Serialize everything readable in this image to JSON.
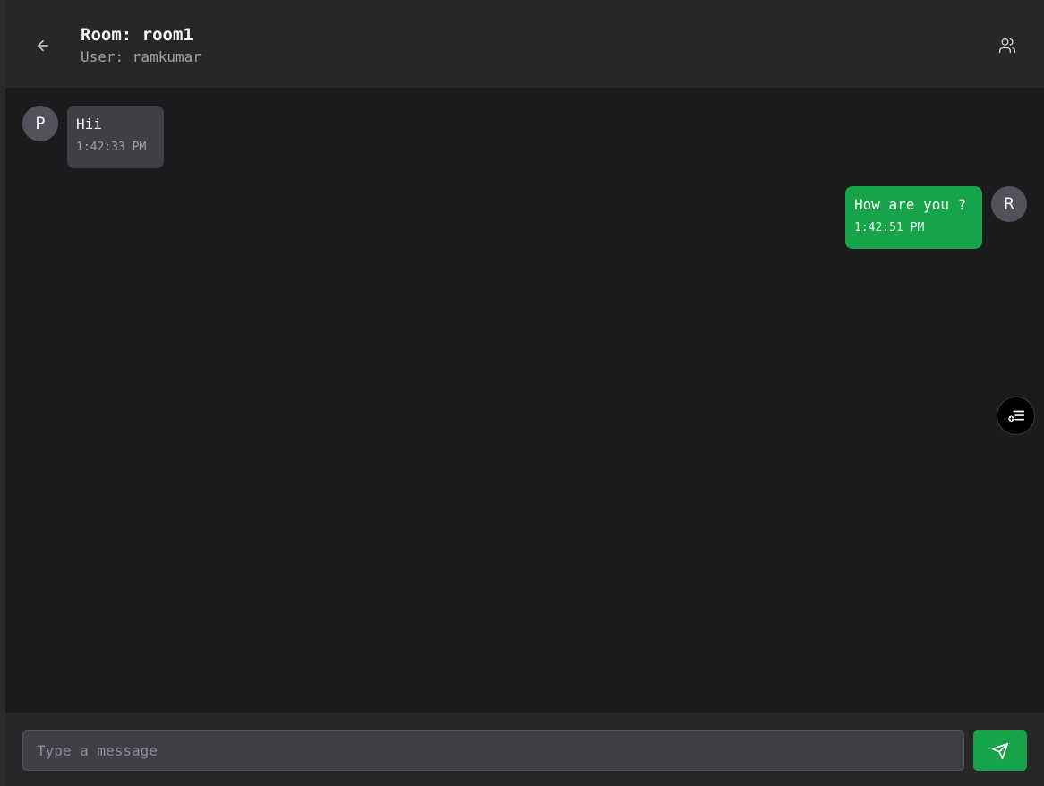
{
  "header": {
    "room_title": "Room: room1",
    "user_line": "User: ramkumar",
    "back_icon": "arrow-left-icon",
    "users_icon": "users-icon"
  },
  "messages": [
    {
      "direction": "incoming",
      "avatar_initial": "P",
      "text": "Hii",
      "time": "1:42:33 PM"
    },
    {
      "direction": "outgoing",
      "avatar_initial": "R",
      "text": "How are you ?",
      "time": "1:42:51 PM"
    }
  ],
  "floating_button": {
    "icon": "list-add-icon"
  },
  "composer": {
    "placeholder": "Type a message",
    "value": "",
    "send_icon": "send-icon"
  },
  "colors": {
    "background": "#1b1b1d",
    "header": "#27272a",
    "incoming_bubble": "#3f3f46",
    "outgoing_bubble": "#16a34a",
    "avatar": "#52525b",
    "send_button": "#16a34a"
  }
}
